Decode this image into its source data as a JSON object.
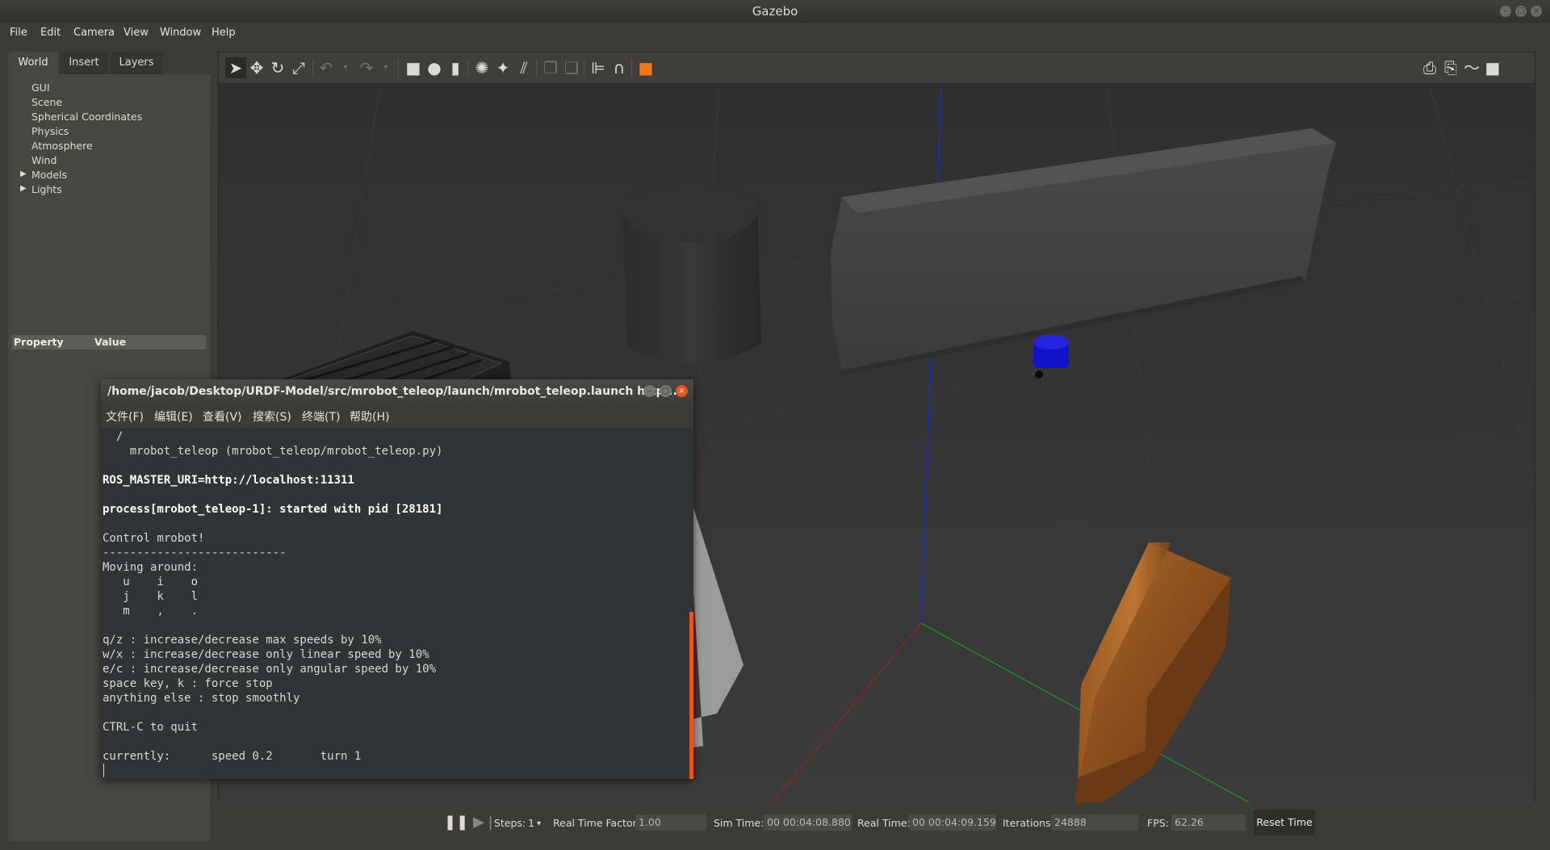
{
  "window": {
    "title": "Gazebo"
  },
  "menubar": [
    "File",
    "Edit",
    "Camera",
    "View",
    "Window",
    "Help"
  ],
  "left_panel": {
    "tabs": [
      "World",
      "Insert",
      "Layers"
    ],
    "tree": [
      "GUI",
      "Scene",
      "Spherical Coordinates",
      "Physics",
      "Atmosphere",
      "Wind",
      "Models",
      "Lights"
    ],
    "property_header": {
      "property": "Property",
      "value": "Value"
    }
  },
  "terminal": {
    "title": "/home/jacob/Desktop/URDF-Model/src/mrobot_teleop/launch/mrobot_teleop.launch http:...",
    "menu": [
      "文件(F)",
      "编辑(E)",
      "查看(V)",
      "搜索(S)",
      "终端(T)",
      "帮助(H)"
    ],
    "lines": [
      {
        "text": "  /",
        "bold": false
      },
      {
        "text": "    mrobot_teleop (mrobot_teleop/mrobot_teleop.py)",
        "bold": false
      },
      {
        "text": "",
        "bold": false
      },
      {
        "text": "ROS_MASTER_URI=http://localhost:11311",
        "bold": true
      },
      {
        "text": "",
        "bold": false
      },
      {
        "text": "process[mrobot_teleop-1]: started with pid [28181]",
        "bold": true
      },
      {
        "text": "",
        "bold": false
      },
      {
        "text": "Control mrobot!",
        "bold": false
      },
      {
        "text": "---------------------------",
        "bold": false
      },
      {
        "text": "Moving around:",
        "bold": false
      },
      {
        "text": "   u    i    o",
        "bold": false
      },
      {
        "text": "   j    k    l",
        "bold": false
      },
      {
        "text": "   m    ,    .",
        "bold": false
      },
      {
        "text": "",
        "bold": false
      },
      {
        "text": "q/z : increase/decrease max speeds by 10%",
        "bold": false
      },
      {
        "text": "w/x : increase/decrease only linear speed by 10%",
        "bold": false
      },
      {
        "text": "e/c : increase/decrease only angular speed by 10%",
        "bold": false
      },
      {
        "text": "space key, k : force stop",
        "bold": false
      },
      {
        "text": "anything else : stop smoothly",
        "bold": false
      },
      {
        "text": "",
        "bold": false
      },
      {
        "text": "CTRL-C to quit",
        "bold": false
      },
      {
        "text": "",
        "bold": false
      },
      {
        "text": "currently:      speed 0.2       turn 1",
        "bold": false
      }
    ]
  },
  "bottom_bar": {
    "steps_label": "Steps:",
    "steps_value": "1",
    "rtf_label": "Real Time Factor:",
    "rtf_value": "1.00",
    "sim_time_label": "Sim Time:",
    "sim_time_value": "00 00:04:08.880",
    "real_time_label": "Real Time:",
    "real_time_value": "00 00:04:09.159",
    "iterations_label": "Iterations:",
    "iterations_value": "24888",
    "fps_label": "FPS:",
    "fps_value": "62.26",
    "reset_label": "Reset Time"
  },
  "icons": {
    "toolbar": [
      "select-arrow-icon",
      "translate-icon",
      "rotate-icon",
      "scale-icon",
      "undo-icon",
      "redo-icon",
      "box-icon",
      "sphere-icon",
      "cylinder-icon",
      "point-light-icon",
      "spot-light-icon",
      "directional-light-icon",
      "copy-icon",
      "paste-icon",
      "align-icon",
      "snap-magnet-icon",
      "view-angle-icon",
      "screenshot-camera-icon",
      "log-icon",
      "plot-icon",
      "record-video-icon"
    ]
  },
  "colors": {
    "accent": "#e95420",
    "robot": "#1212c8",
    "z_axis": "#1a2ad6",
    "x_axis": "#a02020",
    "y_axis": "#1f9a1f"
  }
}
